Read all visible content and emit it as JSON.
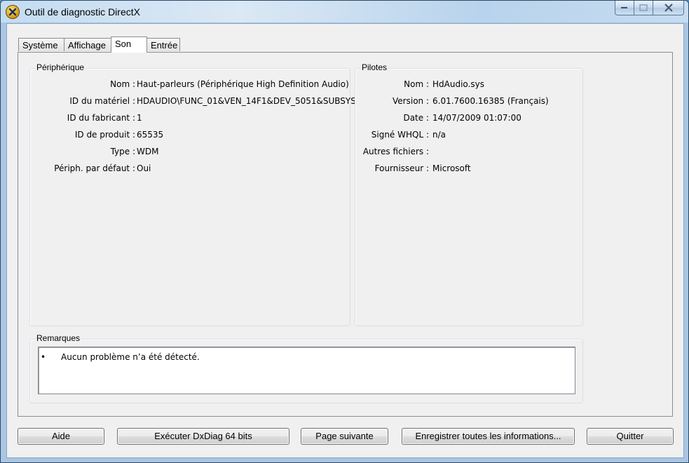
{
  "window": {
    "title": "Outil de diagnostic DirectX",
    "icon": "directx-icon",
    "controls": [
      "minimize",
      "maximize",
      "close"
    ]
  },
  "tabs": [
    {
      "label": "Système",
      "active": false
    },
    {
      "label": "Affichage",
      "active": false
    },
    {
      "label": "Son",
      "active": true
    },
    {
      "label": "Entrée",
      "active": false
    }
  ],
  "device": {
    "title": "Périphérique",
    "rows": [
      {
        "label": "Nom :",
        "value": "Haut-parleurs (Périphérique High Definition Audio)"
      },
      {
        "label": "ID du matériel :",
        "value": "HDAUDIO\\FUNC_01&VEN_14F1&DEV_5051&SUBSYS"
      },
      {
        "label": "ID du fabricant :",
        "value": "1"
      },
      {
        "label": "ID de produit :",
        "value": "65535"
      },
      {
        "label": "Type :",
        "value": "WDM"
      },
      {
        "label": "Périph. par défaut :",
        "value": "Oui"
      }
    ]
  },
  "drivers": {
    "title": "Pilotes",
    "rows": [
      {
        "label": "Nom :",
        "value": "HdAudio.sys"
      },
      {
        "label": "Version :",
        "value": "6.01.7600.16385 (Français)"
      },
      {
        "label": "Date :",
        "value": "14/07/2009 01:07:00"
      },
      {
        "label": "Signé WHQL :",
        "value": "n/a"
      },
      {
        "label": "Autres fichiers :",
        "value": ""
      },
      {
        "label": "Fournisseur :",
        "value": "Microsoft"
      }
    ]
  },
  "notes": {
    "title": "Remarques",
    "bullet": "•",
    "items": [
      "Aucun problème n’a été détecté."
    ]
  },
  "buttons": {
    "help": "Aide",
    "run64": "Exécuter DxDiag 64 bits",
    "next": "Page suivante",
    "save": "Enregistrer toutes les informations...",
    "quit": "Quitter"
  }
}
